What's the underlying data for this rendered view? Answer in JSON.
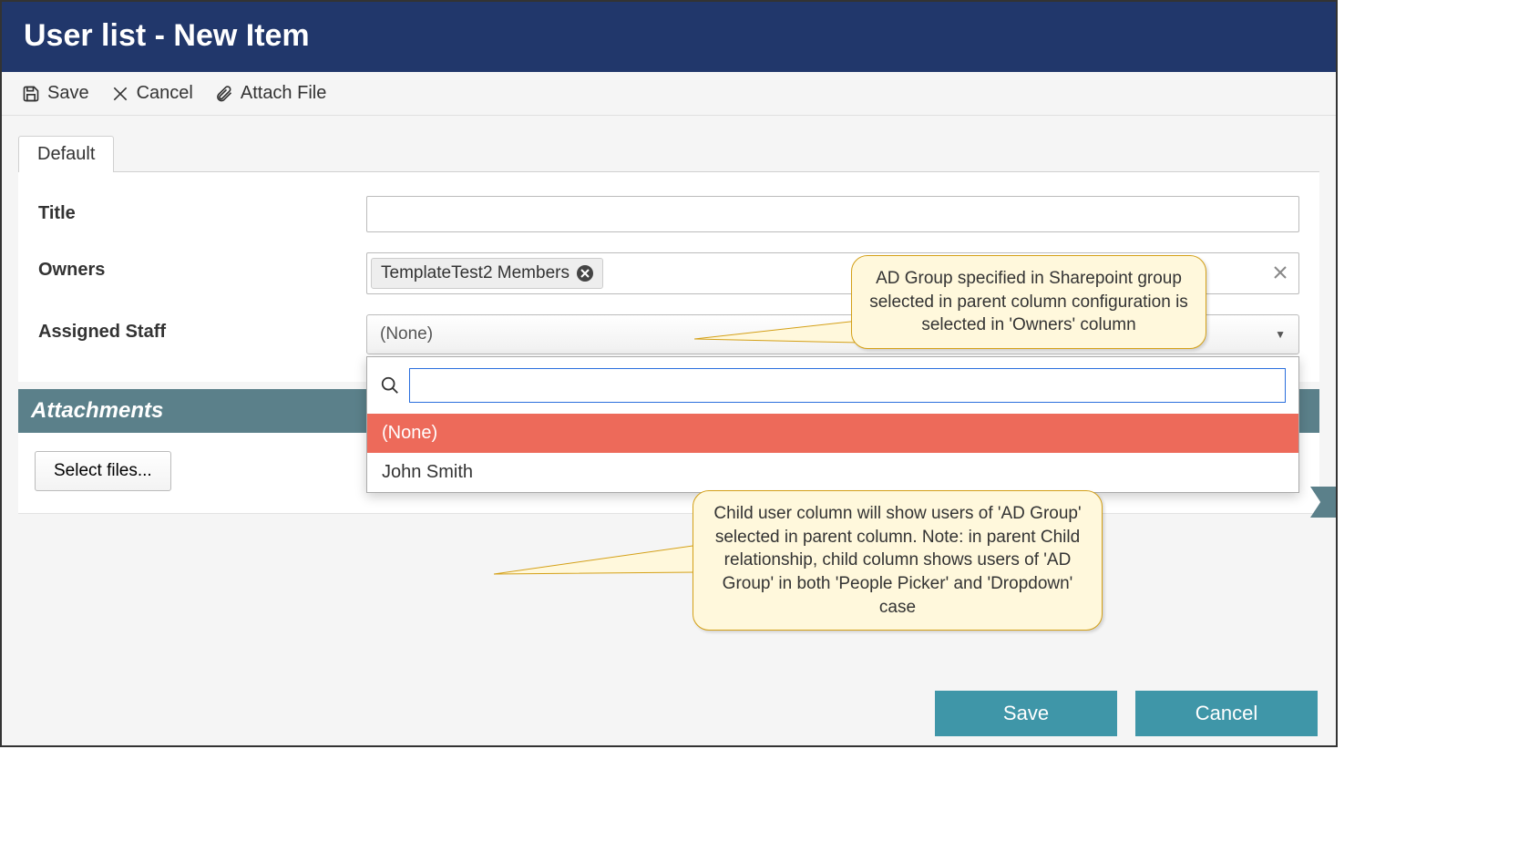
{
  "header": {
    "title": "User list - New Item"
  },
  "toolbar": {
    "save": "Save",
    "cancel": "Cancel",
    "attach": "Attach File"
  },
  "tabs": {
    "default": "Default"
  },
  "form": {
    "title_label": "Title",
    "title_value": "",
    "owners_label": "Owners",
    "owners_chip": "TemplateTest2 Members",
    "assigned_label": "Assigned Staff",
    "assigned_value": "(None)",
    "dropdown": {
      "search_value": "",
      "options": [
        {
          "label": "(None)",
          "selected": true
        },
        {
          "label": "John Smith",
          "selected": false
        }
      ]
    }
  },
  "attachments": {
    "header": "Attachments",
    "select_files": "Select files..."
  },
  "footer": {
    "save": "Save",
    "cancel": "Cancel"
  },
  "callouts": {
    "c1": "AD Group specified in Sharepoint group selected in parent column configuration is selected in 'Owners' column",
    "c2": "Child user column will show users of 'AD Group' selected in parent column. Note: in parent Child relationship, child column shows users of 'AD Group' in both 'People Picker' and 'Dropdown' case"
  }
}
